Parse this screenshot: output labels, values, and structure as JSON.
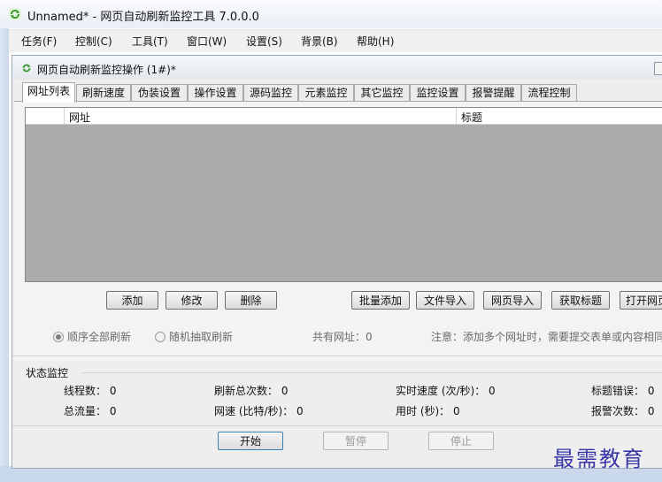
{
  "window": {
    "title": "Unnamed* - 网页自动刷新监控工具 7.0.0.0",
    "icon": "refresh-icon"
  },
  "menu": [
    {
      "label": "任务(F)"
    },
    {
      "label": "控制(C)"
    },
    {
      "label": "工具(T)"
    },
    {
      "label": "窗口(W)"
    },
    {
      "label": "设置(S)"
    },
    {
      "label": "背景(B)"
    },
    {
      "label": "帮助(H)"
    }
  ],
  "child": {
    "title": "网页自动刷新监控操作  (1#)*",
    "tabs": [
      "网址列表",
      "刷新速度",
      "伪装设置",
      "操作设置",
      "源码监控",
      "元素监控",
      "其它监控",
      "监控设置",
      "报警提醒",
      "流程控制"
    ],
    "active_tab": "网址列表",
    "table": {
      "columns": [
        "网址",
        "标题"
      ]
    },
    "buttons": {
      "add": "添加",
      "edit": "修改",
      "delete": "删除",
      "batch_add": "批量添加",
      "file_import": "文件导入",
      "web_import": "网页导入",
      "get_title": "获取标题",
      "open_web": "打开网页"
    },
    "options": {
      "sequential": "顺序全部刷新",
      "random": "随机抽取刷新",
      "total_urls": "共有网址：0",
      "note": "注意：添加多个网址时，需要提交表单或内容相同的"
    },
    "status": {
      "title": "状态监控",
      "threads": "线程数： 0",
      "refresh_total": "刷新总次数： 0",
      "realtime_speed": "实时速度 (次/秒)： 0",
      "title_errors": "标题错误： 0",
      "total_traffic": "总流量： 0",
      "net_speed": "网速 (比特/秒)： 0",
      "elapsed": "用时 (秒)： 0",
      "alarms": "报警次数： 0"
    },
    "controls": {
      "start": "开始",
      "pause": "暂停",
      "stop": "停止"
    }
  },
  "watermark": "最需教育"
}
